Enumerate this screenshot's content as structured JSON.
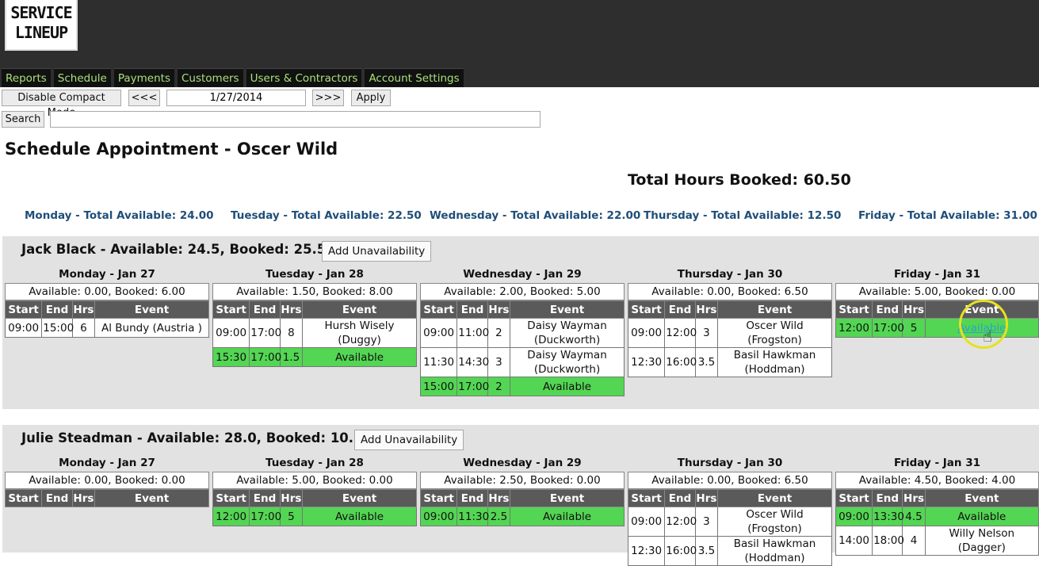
{
  "app": {
    "logo_line1": "SERVICE",
    "logo_line2": "LINEUP"
  },
  "nav": [
    "Reports",
    "Schedule",
    "Payments",
    "Customers",
    "Users & Contractors",
    "Account Settings"
  ],
  "toolbar": {
    "compact": "Disable Compact Mode",
    "prev": "<<<",
    "date": "1/27/2014",
    "next": ">>>",
    "apply": "Apply",
    "search": "Search",
    "search_value": ""
  },
  "page_title": "Schedule Appointment - Oscer Wild",
  "total_booked": "Total Hours Booked: 60.50",
  "day_totals": [
    "Monday - Total Available: 24.00",
    "Tuesday - Total Available: 22.50",
    "Wednesday - Total Available: 22.00",
    "Thursday - Total Available: 12.50",
    "Friday - Total Available: 31.00"
  ],
  "columns": {
    "start": "Start",
    "end": "End",
    "hrs": "Hrs",
    "event": "Event"
  },
  "colors": {
    "available_green": "#53d653",
    "nav_text": "#a9e07a",
    "day_total": "#1f4e79"
  },
  "people": [
    {
      "name": "Jack Black - Available: 24.5, Booked: 25.50",
      "add_label": "Add Unavailability",
      "days": [
        {
          "header": "Monday - Jan 27",
          "summary": "Available: 0.00, Booked: 6.00",
          "rows": [
            {
              "start": "09:00",
              "end": "15:00",
              "hrs": "6",
              "event": "Al Bundy (Austria )",
              "available": false
            }
          ]
        },
        {
          "header": "Tuesday - Jan 28",
          "summary": "Available: 1.50, Booked: 8.00",
          "rows": [
            {
              "start": "09:00",
              "end": "17:00",
              "hrs": "8",
              "event": "Hursh Wisely (Duggy)",
              "available": false
            },
            {
              "start": "15:30",
              "end": "17:00",
              "hrs": "1.5",
              "event": "Available",
              "available": true
            }
          ]
        },
        {
          "header": "Wednesday - Jan 29",
          "summary": "Available: 2.00, Booked: 5.00",
          "rows": [
            {
              "start": "09:00",
              "end": "11:00",
              "hrs": "2",
              "event": "Daisy Wayman (Duckworth)",
              "available": false
            },
            {
              "start": "11:30",
              "end": "14:30",
              "hrs": "3",
              "event": "Daisy Wayman (Duckworth)",
              "available": false
            },
            {
              "start": "15:00",
              "end": "17:00",
              "hrs": "2",
              "event": "Available",
              "available": true
            }
          ]
        },
        {
          "header": "Thursday - Jan 30",
          "summary": "Available: 0.00, Booked: 6.50",
          "rows": [
            {
              "start": "09:00",
              "end": "12:00",
              "hrs": "3",
              "event": "Oscer Wild (Frogston)",
              "available": false
            },
            {
              "start": "12:30",
              "end": "16:00",
              "hrs": "3.5",
              "event": "Basil Hawkman (Hoddman)",
              "available": false
            }
          ]
        },
        {
          "header": "Friday - Jan 31",
          "summary": "Available: 5.00, Booked: 0.00",
          "rows": [
            {
              "start": "12:00",
              "end": "17:00",
              "hrs": "5",
              "event": "Available",
              "available": true,
              "link": true
            }
          ]
        }
      ]
    },
    {
      "name": "Julie Steadman - Available: 28.0, Booked: 10.50",
      "add_label": "Add Unavailability",
      "days": [
        {
          "header": "Monday - Jan 27",
          "summary": "Available: 0.00, Booked: 0.00",
          "rows": []
        },
        {
          "header": "Tuesday - Jan 28",
          "summary": "Available: 5.00, Booked: 0.00",
          "rows": [
            {
              "start": "12:00",
              "end": "17:00",
              "hrs": "5",
              "event": "Available",
              "available": true
            }
          ]
        },
        {
          "header": "Wednesday - Jan 29",
          "summary": "Available: 2.50, Booked: 0.00",
          "rows": [
            {
              "start": "09:00",
              "end": "11:30",
              "hrs": "2.5",
              "event": "Available",
              "available": true
            }
          ]
        },
        {
          "header": "Thursday - Jan 30",
          "summary": "Available: 0.00, Booked: 6.50",
          "rows": [
            {
              "start": "09:00",
              "end": "12:00",
              "hrs": "3",
              "event": "Oscer Wild (Frogston)",
              "available": false
            },
            {
              "start": "12:30",
              "end": "16:00",
              "hrs": "3.5",
              "event": "Basil Hawkman (Hoddman)",
              "available": false
            }
          ]
        },
        {
          "header": "Friday - Jan 31",
          "summary": "Available: 4.50, Booked: 4.00",
          "rows": [
            {
              "start": "09:00",
              "end": "13:30",
              "hrs": "4.5",
              "event": "Available",
              "available": true
            },
            {
              "start": "14:00",
              "end": "18:00",
              "hrs": "4",
              "event": "Willy Nelson (Dagger)",
              "available": false
            }
          ]
        }
      ]
    }
  ]
}
